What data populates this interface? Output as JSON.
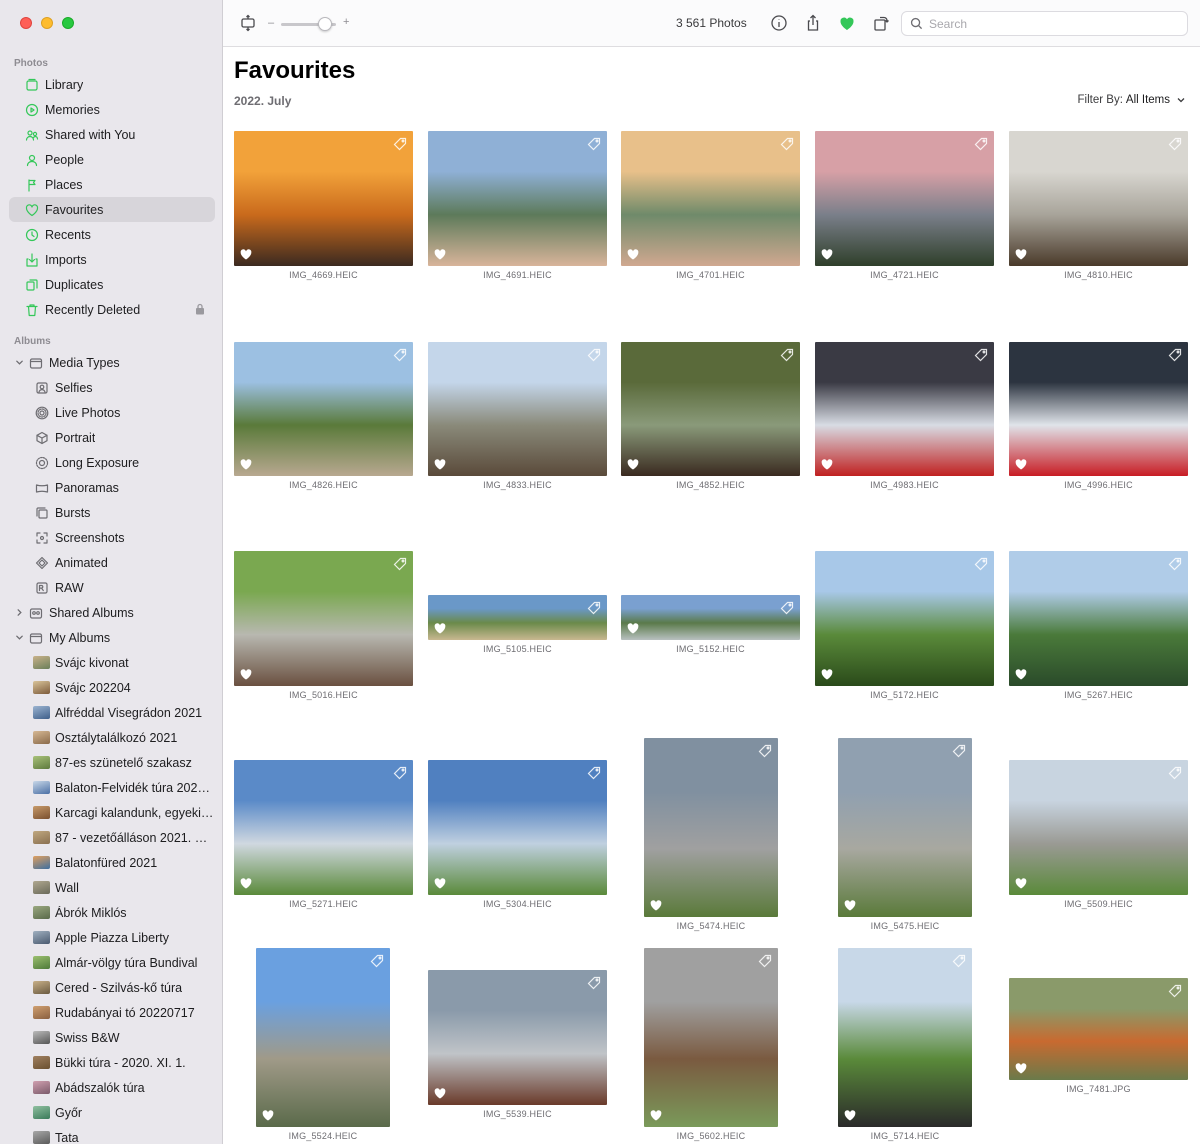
{
  "window": {
    "title": "Photos"
  },
  "sidebar": {
    "photos_header": "Photos",
    "library_items": [
      {
        "label": "Library",
        "icon": "library-icon"
      },
      {
        "label": "Memories",
        "icon": "memories-icon"
      },
      {
        "label": "Shared with You",
        "icon": "shared-with-you-icon"
      },
      {
        "label": "People",
        "icon": "people-icon"
      },
      {
        "label": "Places",
        "icon": "places-icon"
      },
      {
        "label": "Favourites",
        "icon": "heart-icon",
        "selected": true
      },
      {
        "label": "Recents",
        "icon": "clock-icon"
      },
      {
        "label": "Imports",
        "icon": "import-icon"
      },
      {
        "label": "Duplicates",
        "icon": "duplicates-icon"
      },
      {
        "label": "Recently Deleted",
        "icon": "trash-icon",
        "locked": true
      }
    ],
    "albums_header": "Albums",
    "media_types_label": "Media Types",
    "media_types": [
      {
        "label": "Selfies",
        "icon": "selfie-icon"
      },
      {
        "label": "Live Photos",
        "icon": "live-photo-icon"
      },
      {
        "label": "Portrait",
        "icon": "portrait-icon"
      },
      {
        "label": "Long Exposure",
        "icon": "long-exposure-icon"
      },
      {
        "label": "Panoramas",
        "icon": "panorama-icon"
      },
      {
        "label": "Bursts",
        "icon": "bursts-icon"
      },
      {
        "label": "Screenshots",
        "icon": "screenshot-icon"
      },
      {
        "label": "Animated",
        "icon": "animated-icon"
      },
      {
        "label": "RAW",
        "icon": "raw-icon"
      }
    ],
    "shared_albums_label": "Shared Albums",
    "my_albums_label": "My Albums",
    "my_albums": [
      {
        "label": "Svájc kivonat",
        "thumb": [
          "#6a7f5a",
          "#c9b28a"
        ]
      },
      {
        "label": "Svájc 202204",
        "thumb": [
          "#7c5a3a",
          "#d9c49a"
        ]
      },
      {
        "label": "Alfréddal Visegrádon 2021",
        "thumb": [
          "#3f5f8a",
          "#9bb4d1"
        ]
      },
      {
        "label": "Osztálytalálkozó 2021",
        "thumb": [
          "#8a6a4a",
          "#d6b894"
        ]
      },
      {
        "label": "87-es szünetelő szakasz",
        "thumb": [
          "#5e7a3e",
          "#a9c27a"
        ]
      },
      {
        "label": "Balaton-Felvidék túra 202…",
        "thumb": [
          "#4a6fa5",
          "#c8d7e8"
        ]
      },
      {
        "label": "Karcagi kalandunk, egyeki…",
        "thumb": [
          "#7a5030",
          "#c79a6a"
        ]
      },
      {
        "label": "87 - vezetőálláson 2021. V…",
        "thumb": [
          "#8a7050",
          "#c0a880"
        ]
      },
      {
        "label": "Balatonfüred 2021",
        "thumb": [
          "#3e6fa0",
          "#e0a060"
        ]
      },
      {
        "label": "Wall",
        "thumb": [
          "#6a6a5a",
          "#b0a890"
        ]
      },
      {
        "label": "Ábrók Miklós",
        "thumb": [
          "#5a6a4a",
          "#9aa880"
        ]
      },
      {
        "label": "Apple Piazza Liberty",
        "thumb": [
          "#4a5a70",
          "#a0b0c0"
        ]
      },
      {
        "label": "Almár-völgy túra Bundival",
        "thumb": [
          "#4e7a3a",
          "#9cc070"
        ]
      },
      {
        "label": "Cered - Szilvás-kő túra",
        "thumb": [
          "#6a5a40",
          "#c8b088"
        ]
      },
      {
        "label": "Rudabányai tó 20220717",
        "thumb": [
          "#8a6040",
          "#d0a070"
        ]
      },
      {
        "label": "Swiss B&W",
        "thumb": [
          "#555555",
          "#bbbbbb"
        ]
      },
      {
        "label": "Bükki túra - 2020. XI. 1.",
        "thumb": [
          "#6a5030",
          "#a08060"
        ]
      },
      {
        "label": "Abádszalók túra",
        "thumb": [
          "#7a5a6a",
          "#d0a0b0"
        ]
      },
      {
        "label": "Győr",
        "thumb": [
          "#3a7a5a",
          "#90c0a0"
        ]
      },
      {
        "label": "Tata",
        "thumb": [
          "#5a5a5a",
          "#a8a8a8"
        ]
      }
    ]
  },
  "toolbar": {
    "photo_count": "3 561 Photos",
    "zoom_minus": "–",
    "zoom_plus": "+",
    "zoom_level": 0.8,
    "search_placeholder": "Search",
    "accent": "#34c759"
  },
  "main": {
    "title": "Favourites",
    "subtitle": "2022. July",
    "filter_label": "Filter By:",
    "filter_value": "All Items",
    "photos": [
      {
        "name": "IMG_4669.HEIC",
        "colors": [
          "#f2a23a",
          "#c96a1c",
          "#3b2a20"
        ]
      },
      {
        "name": "IMG_4691.HEIC",
        "colors": [
          "#8fb0d6",
          "#5d7a5a",
          "#d8b49a"
        ]
      },
      {
        "name": "IMG_4701.HEIC",
        "colors": [
          "#e8c08a",
          "#6f8a6a",
          "#d0a890"
        ]
      },
      {
        "name": "IMG_4721.HEIC",
        "colors": [
          "#d7a0a6",
          "#7a7f8a",
          "#2f3f2a"
        ]
      },
      {
        "name": "IMG_4810.HEIC",
        "colors": [
          "#d8d6d0",
          "#a8a49a",
          "#4a3a2a"
        ]
      },
      {
        "name": "IMG_4826.HEIC",
        "colors": [
          "#9cc0e2",
          "#5a7a3a",
          "#b8a890"
        ]
      },
      {
        "name": "IMG_4833.HEIC",
        "colors": [
          "#c4d6ea",
          "#8a8a7a",
          "#5a4a3a"
        ]
      },
      {
        "name": "IMG_4852.HEIC",
        "colors": [
          "#5a6a3a",
          "#8a9a7a",
          "#3a2a20"
        ]
      },
      {
        "name": "IMG_4983.HEIC",
        "colors": [
          "#3a3a44",
          "#d8dce4",
          "#c02020"
        ]
      },
      {
        "name": "IMG_4996.HEIC",
        "colors": [
          "#2c3440",
          "#e0e4ea",
          "#c81c24"
        ]
      },
      {
        "name": "IMG_5016.HEIC",
        "colors": [
          "#7aa850",
          "#b8b8b0",
          "#6a5040"
        ]
      },
      {
        "name": "IMG_5105.HEIC",
        "colors": [
          "#6a98c8",
          "#6a8a4a",
          "#c8b890"
        ]
      },
      {
        "name": "IMG_5152.HEIC",
        "colors": [
          "#7aa0d0",
          "#5a7a4a",
          "#b8c0c0"
        ]
      },
      {
        "name": "IMG_5172.HEIC",
        "colors": [
          "#a8c8e8",
          "#5a8a3a",
          "#2a4a1a"
        ]
      },
      {
        "name": "IMG_5267.HEIC",
        "colors": [
          "#b0cce8",
          "#4a7a3a",
          "#2a4a2a"
        ]
      },
      {
        "name": "IMG_5271.HEIC",
        "colors": [
          "#5a8ac8",
          "#d0d8e0",
          "#5a8a3a"
        ]
      },
      {
        "name": "IMG_5304.HEIC",
        "colors": [
          "#5080c0",
          "#c0d0e0",
          "#5a8a3a"
        ]
      },
      {
        "name": "IMG_5474.HEIC",
        "colors": [
          "#8090a0",
          "#a0a0a0",
          "#5a7a3a"
        ]
      },
      {
        "name": "IMG_5475.HEIC",
        "colors": [
          "#90a0b0",
          "#a8a8a0",
          "#5a7a3a"
        ]
      },
      {
        "name": "IMG_5509.HEIC",
        "colors": [
          "#c8d4e0",
          "#9a9a94",
          "#5a8a3a"
        ]
      },
      {
        "name": "IMG_5524.HEIC",
        "colors": [
          "#6aa0e0",
          "#a09a88",
          "#5a6a4a"
        ]
      },
      {
        "name": "IMG_5539.HEIC",
        "colors": [
          "#8a9aaa",
          "#c0c4c8",
          "#6a3a2a"
        ]
      },
      {
        "name": "IMG_5602.HEIC",
        "colors": [
          "#a0a0a0",
          "#7a5a40",
          "#7a9a5a"
        ]
      },
      {
        "name": "IMG_5714.HEIC",
        "colors": [
          "#c8d8e8",
          "#5a8a3a",
          "#2a2a2a"
        ]
      },
      {
        "name": "IMG_7481.JPG",
        "colors": [
          "#8a9a6a",
          "#c86a30",
          "#6a7a4a"
        ]
      }
    ]
  }
}
